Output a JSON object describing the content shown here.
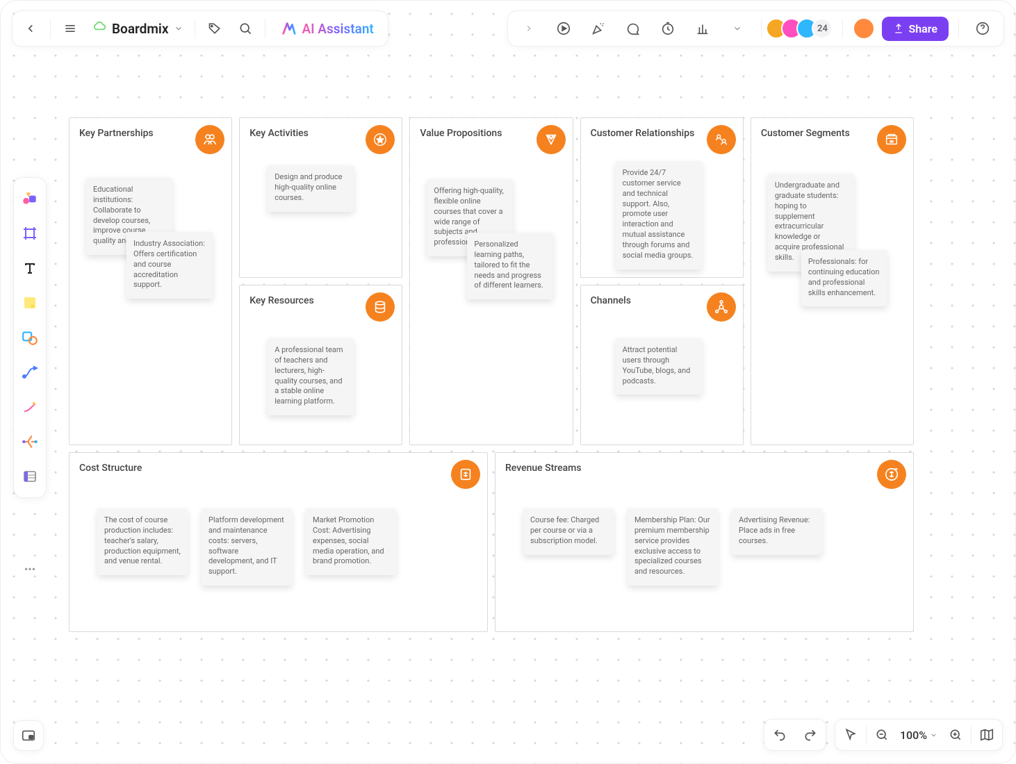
{
  "app": {
    "board_name": "Boardmix",
    "ai_label": "AI Assistant"
  },
  "collab": {
    "extra_count": "24",
    "share_label": "Share"
  },
  "zoom": {
    "label": "100%"
  },
  "bmc": {
    "key_partnerships": {
      "title": "Key Partnerships",
      "notes": [
        "Educational institutions: Collaborate to develop courses, improve course quality and authority.",
        "Industry Association: Offers certification and course accreditation support."
      ]
    },
    "key_activities": {
      "title": "Key Activities",
      "notes": [
        "Design and produce high-quality online courses."
      ]
    },
    "key_resources": {
      "title": "Key Resources",
      "notes": [
        "A professional team of teachers and lecturers, high-quality courses, and a stable online learning platform."
      ]
    },
    "value_propositions": {
      "title": "Value Propositions",
      "notes": [
        "Offering high-quality, flexible online courses that cover a wide range of subjects and professional skills.",
        "Personalized learning paths, tailored to fit the needs and progress of different learners."
      ]
    },
    "customer_relationships": {
      "title": "Customer Relationships",
      "notes": [
        "Provide 24/7 customer service and technical support. Also, promote user interaction and mutual assistance through forums and social media groups."
      ]
    },
    "channels": {
      "title": "Channels",
      "notes": [
        "Attract potential users through YouTube, blogs, and podcasts."
      ]
    },
    "customer_segments": {
      "title": "Customer Segments",
      "notes": [
        "Undergraduate and graduate students: hoping to supplement extracurricular knowledge or acquire professional skills.",
        "Professionals: for continuing education and professional skills enhancement."
      ]
    },
    "cost_structure": {
      "title": "Cost Structure",
      "notes": [
        "The cost of course production includes: teacher's salary, production equipment, and venue rental.",
        "Platform development and maintenance costs: servers, software development, and IT support.",
        "Market Promotion Cost: Advertising expenses, social media operation, and brand promotion."
      ]
    },
    "revenue_streams": {
      "title": "Revenue Streams",
      "notes": [
        "Course fee: Charged per course or via a subscription model.",
        "Membership Plan: Our premium membership service provides exclusive access to specialized courses and resources.",
        "Advertising Revenue: Place ads in free courses."
      ]
    }
  }
}
